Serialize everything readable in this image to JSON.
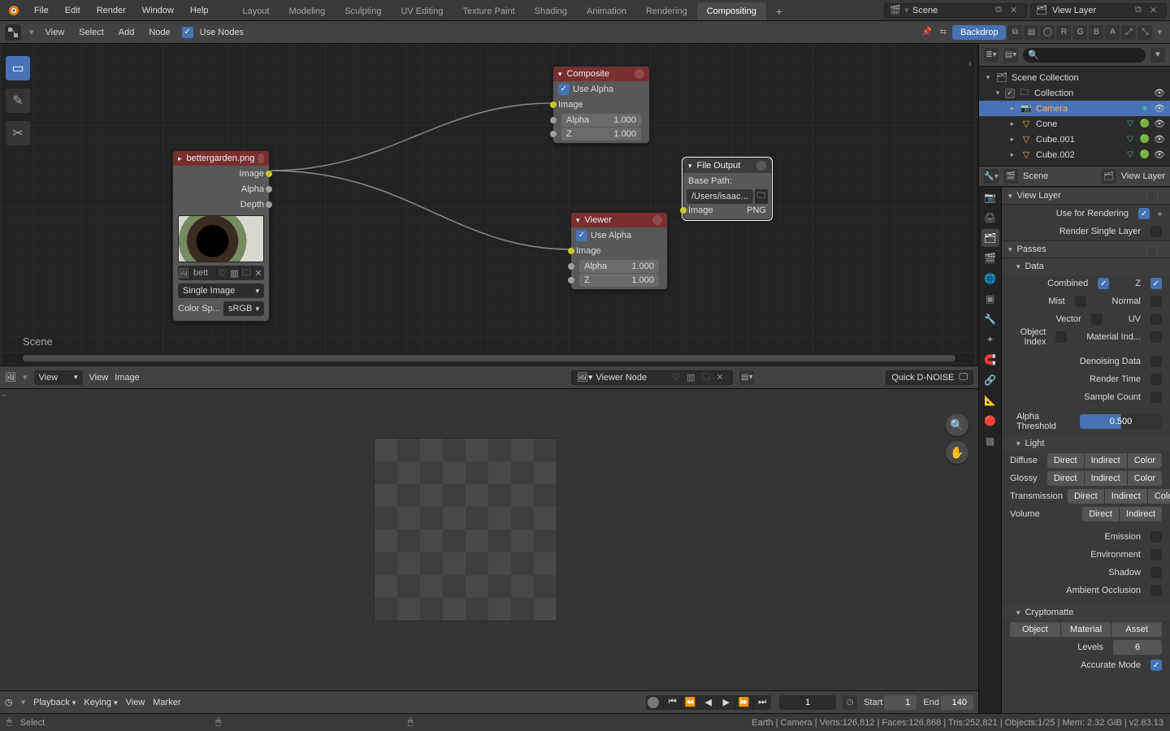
{
  "top_menu": {
    "file": "File",
    "edit": "Edit",
    "render": "Render",
    "window": "Window",
    "help": "Help"
  },
  "workspaces": {
    "items": [
      "Layout",
      "Modeling",
      "Sculpting",
      "UV Editing",
      "Texture Paint",
      "Shading",
      "Animation",
      "Rendering",
      "Compositing"
    ],
    "active": "Compositing",
    "add": "+"
  },
  "scene_field": {
    "label": "Scene"
  },
  "viewlayer_field": {
    "label": "View Layer"
  },
  "node_header": {
    "view": "View",
    "select": "Select",
    "add": "Add",
    "node": "Node",
    "use_nodes": "Use Nodes",
    "backdrop": "Backdrop",
    "channels": [
      "⧉",
      "▤",
      "◯",
      "R",
      "G",
      "B",
      "A"
    ],
    "pin_icon": "📌",
    "arrow_icon": "↔"
  },
  "tools": {
    "select": "▭",
    "annotate": "✎",
    "cut": "✂"
  },
  "scene_label": "Scene",
  "nodes": {
    "image": {
      "title": "bettergarden.png",
      "outputs": [
        "Image",
        "Alpha",
        "Depth"
      ],
      "file_label": "bett",
      "source": "Single Image",
      "colorspace_label": "Color Sp...",
      "colorspace": "sRGB"
    },
    "composite": {
      "title": "Composite",
      "use_alpha": "Use Alpha",
      "inputs_img": "Image",
      "alpha_label": "Alpha",
      "alpha_val": "1.000",
      "z_label": "Z",
      "z_val": "1.000"
    },
    "viewer": {
      "title": "Viewer",
      "use_alpha": "Use Alpha",
      "inputs_img": "Image",
      "alpha_label": "Alpha",
      "alpha_val": "1.000",
      "z_label": "Z",
      "z_val": "1.000"
    },
    "fileout": {
      "title": "File Output",
      "base_path_label": "Base Path:",
      "path": "/Users/isaac...",
      "img_label": "Image",
      "fmt": "PNG"
    }
  },
  "img_editor": {
    "view_dd": "View",
    "view": "View",
    "image": "Image",
    "combo": "Viewer Node",
    "dnoise": "Quick D-NOISE"
  },
  "timeline": {
    "playback": "Playback",
    "keying": "Keying",
    "view": "View",
    "marker": "Marker",
    "cur": "1",
    "start_l": "Start",
    "start": "1",
    "end_l": "End",
    "end": "140"
  },
  "status": {
    "left": "Select",
    "right": "Earth | Camera | Verts:126,812 | Faces:126,868 | Tris:252,821 | Objects:1/25 | Mem: 2.32 GiB | v2.83.13"
  },
  "outliner": {
    "root": "Scene Collection",
    "collection": "Collection",
    "items": [
      {
        "name": "Camera",
        "cam": true
      },
      {
        "name": "Cone"
      },
      {
        "name": "Cube.001"
      },
      {
        "name": "Cube.002"
      }
    ]
  },
  "props_header": {
    "scene": "Scene",
    "viewlayer": "View Layer"
  },
  "props": {
    "viewlayer": "View Layer",
    "use_for_rendering": "Use for Rendering",
    "render_single": "Render Single Layer",
    "passes": "Passes",
    "data": "Data",
    "combined": "Combined",
    "z": "Z",
    "mist": "Mist",
    "normal": "Normal",
    "vector": "Vector",
    "uv": "UV",
    "objidx": "Object Index",
    "matidx": "Material Ind...",
    "denoise": "Denoising Data",
    "rendertime": "Render Time",
    "samplecnt": "Sample Count",
    "alpha_t_label": "Alpha Threshold",
    "alpha_t": "0.500",
    "light": "Light",
    "diffuse": "Diffuse",
    "glossy": "Glossy",
    "trans": "Transmission",
    "volume": "Volume",
    "direct": "Direct",
    "indirect": "Indirect",
    "color": "Color",
    "emission": "Emission",
    "environment": "Environment",
    "shadow": "Shadow",
    "ao": "Ambient Occlusion",
    "crypto": "Cryptomatte",
    "object": "Object",
    "material": "Material",
    "asset": "Asset",
    "levels_l": "Levels",
    "levels": "6",
    "accurate": "Accurate Mode"
  }
}
